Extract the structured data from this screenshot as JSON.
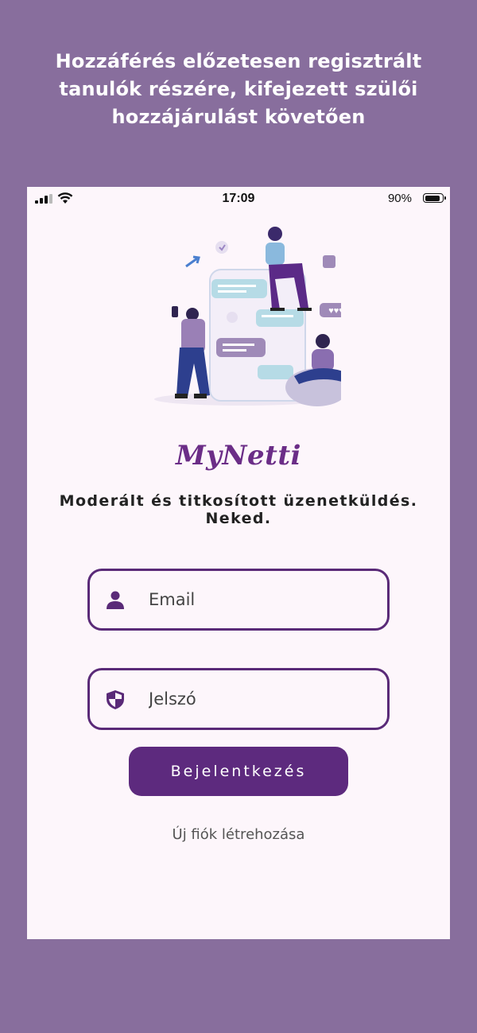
{
  "banner": {
    "headline": "Hozzáférés előzetesen regisztrált tanulók részére, kifejezett szülői hozzájárulást követően"
  },
  "status_bar": {
    "time": "17:09",
    "battery_percent": "90%",
    "battery_level": 0.9,
    "icons": [
      "cellular-signal-icon",
      "wifi-icon",
      "battery-icon"
    ]
  },
  "app": {
    "name": "MyNetti",
    "tagline": "Moderált és titkosított üzenetküldés. Neked."
  },
  "login_form": {
    "email": {
      "placeholder": "Email",
      "value": "",
      "icon": "person-icon"
    },
    "password": {
      "placeholder": "Jelszó",
      "value": "",
      "icon": "shield-icon"
    },
    "submit_label": "Bejelentkezés",
    "create_account_label": "Új fiók létrehozása"
  },
  "colors": {
    "background": "#886e9d",
    "screen": "#fdf6fb",
    "accent": "#5d2a7e",
    "brand": "#6b2d87"
  }
}
